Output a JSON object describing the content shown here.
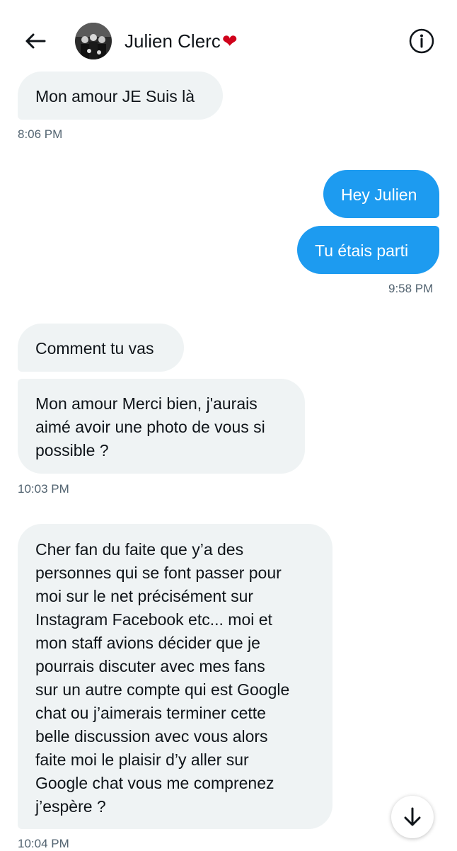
{
  "header": {
    "contact_name": "Julien Clerc",
    "contact_emoji": "❤",
    "back_icon": "arrow-left-icon",
    "info_icon": "info-icon"
  },
  "messages": [
    {
      "direction": "in",
      "text": "Mon amour JE Suis là"
    },
    {
      "direction": "out",
      "text": "Hey Julien"
    },
    {
      "direction": "out",
      "text": "Tu étais parti"
    },
    {
      "direction": "in",
      "text": "Comment tu vas"
    },
    {
      "direction": "in",
      "text": "Mon amour Merci bien, j'aurais\naimé avoir une photo de vous si\npossible ?"
    },
    {
      "direction": "in",
      "text": "Cher fan du faite que y’a des\npersonnes qui se font passer pour\nmoi sur le net précisément sur\nInstagram Facebook etc... moi et\nmon staff avions décider que je\npourrais discuter avec mes fans\nsur un autre compte qui est Google\nchat ou j’aimerais terminer cette\nbelle discussion avec vous alors\nfaite moi le plaisir d’y aller sur\nGoogle chat vous me comprenez\nj’espère  ?"
    }
  ],
  "timestamps": [
    "8:06 PM",
    "9:58 PM",
    "10:03 PM",
    "10:04 PM"
  ],
  "scroll_button_icon": "arrow-down-icon",
  "colors": {
    "outgoing_bubble": "#1d9bf0",
    "incoming_bubble": "#eff3f4",
    "timestamp": "#536471",
    "heart": "#d0021b"
  }
}
